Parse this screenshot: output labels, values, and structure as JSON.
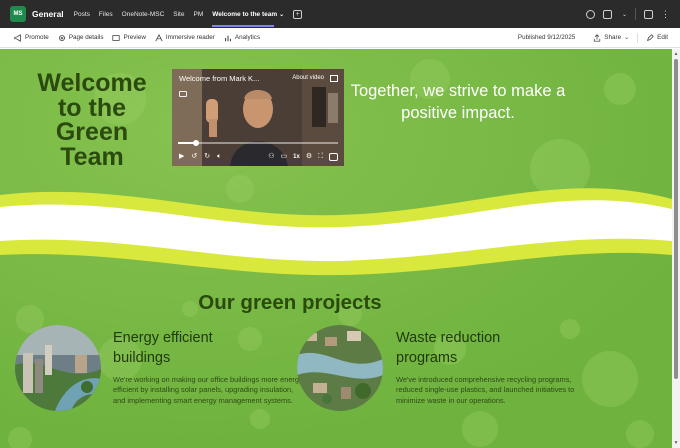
{
  "teams": {
    "avatar_initials": "MS",
    "channel": "General",
    "tabs": [
      {
        "label": "Posts",
        "active": false
      },
      {
        "label": "Files",
        "active": false
      },
      {
        "label": "OneNote-MSC",
        "active": false
      },
      {
        "label": "Site",
        "active": false
      },
      {
        "label": "PM",
        "active": false
      },
      {
        "label": "Welcome to the team",
        "active": true
      }
    ],
    "tab_chevron": "⌄",
    "add_tab": "+"
  },
  "commandbar": {
    "promote": "Promote",
    "page_details": "Page details",
    "preview": "Preview",
    "immersive_reader": "Immersive reader",
    "analytics": "Analytics",
    "published": "Published 9/12/2025",
    "share": "Share",
    "edit": "Edit"
  },
  "hero": {
    "title": "Welcome to the Green Team",
    "tagline": "Together, we strive to make a positive impact."
  },
  "video": {
    "title": "Welcome from Mark K...",
    "about": "About video",
    "speed": "1x",
    "progress_fraction": 0.11
  },
  "section": {
    "title": "Our green projects",
    "projects": [
      {
        "title": "Energy efficient buildings",
        "description": "We're working on making our office buildings more energy efficient by installing solar panels, upgrading insulation, and implementing smart energy management systems."
      },
      {
        "title": "Waste reduction programs",
        "description": "We've introduced comprehensive recycling programs, reduced single-use plastics, and launched initiatives to minimize waste in our operations."
      }
    ]
  },
  "colors": {
    "teams_bar": "#2b2b2b",
    "canvas_green": "#78b845",
    "title_green": "#2a4a0e",
    "wave_yellow": "#d8e83c",
    "accent_tab": "#7f85f5"
  },
  "icons": {
    "promote": "megaphone-icon",
    "page_details": "gear-icon",
    "preview": "preview-icon",
    "immersive_reader": "reader-icon",
    "analytics": "chart-icon",
    "share": "share-icon",
    "edit": "pencil-icon"
  }
}
